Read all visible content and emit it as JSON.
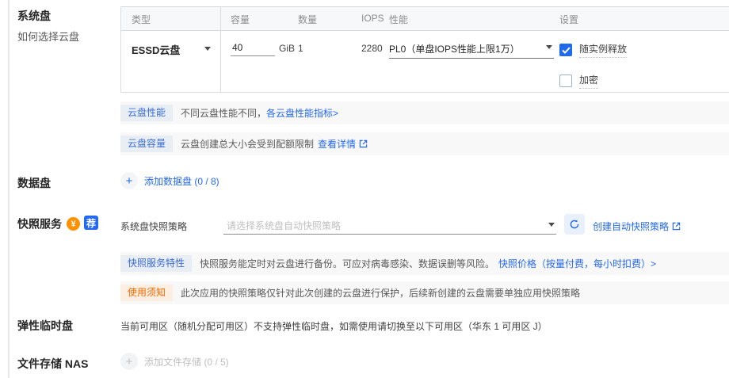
{
  "colors": {
    "accent_blue": "#2468f2",
    "checkbox_blue": "#1f6aec",
    "badge_orange": "#ff9000",
    "tag_orange_text": "#ff6a00",
    "strip_bg": "#f8f8f9"
  },
  "system_disk": {
    "label": "系统盘",
    "help_link": "如何选择云盘",
    "table": {
      "headers": {
        "type": "类型",
        "capacity": "容量",
        "quantity": "数量",
        "iops": "IOPS",
        "performance": "性能",
        "settings": "设置"
      },
      "row": {
        "type_value": "ESSD云盘",
        "capacity_value": "40",
        "capacity_unit": "GiB",
        "quantity_value": "1",
        "iops_value": "2280",
        "performance_value": "PL0（单盘IOPS性能上限1万）",
        "release_label": "随实例释放",
        "encrypt_label": "加密"
      }
    },
    "notes": [
      {
        "tag": "云盘性能",
        "text": "不同云盘性能不同，",
        "link": "各云盘性能指标>"
      },
      {
        "tag": "云盘容量",
        "text": "云盘创建总大小会受到配额限制",
        "link": "查看详情"
      }
    ]
  },
  "data_disk": {
    "label": "数据盘",
    "plus_icon": "+",
    "add_link": "添加数据盘 (0 / 8)"
  },
  "snapshot": {
    "label": "快照服务",
    "money_badge": "¥",
    "recommend_badge": "荐",
    "field_label": "系统盘快照策略",
    "select_placeholder": "请选择系统盘自动快照策略",
    "create_link": "创建自动快照策略",
    "feature_note": {
      "tag": "快照服务特性",
      "text": "快照服务能定时对云盘进行备份。可应对病毒感染、数据误删等风险。",
      "link": "快照价格（按量付费，每小时扣费）>"
    },
    "usage_note": {
      "tag": "使用须知",
      "text": "此次应用的快照策略仅针对此次创建的云盘进行保护，后续新创建的云盘需要单独应用快照策略"
    }
  },
  "ephemeral_disk": {
    "label": "弹性临时盘",
    "text": "当前可用区（随机分配可用区）不支持弹性临时盘，如需使用请切换至以下可用区（华东 1 可用区 J）"
  },
  "nas": {
    "label": "文件存储 NAS",
    "plus_icon": "+",
    "add_link": "添加文件存储 (0 / 5)"
  }
}
